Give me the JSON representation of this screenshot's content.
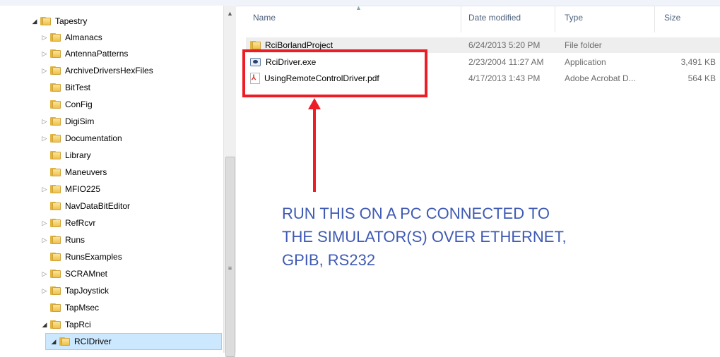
{
  "navigation": {
    "items": [
      {
        "label": "Tapestry",
        "expander": "open"
      },
      {
        "label": "Almanacs",
        "expander": "closed"
      },
      {
        "label": "AntennaPatterns",
        "expander": "closed"
      },
      {
        "label": "ArchiveDriversHexFiles",
        "expander": "closed"
      },
      {
        "label": "BitTest",
        "expander": "none"
      },
      {
        "label": "ConFig",
        "expander": "none"
      },
      {
        "label": "DigiSim",
        "expander": "closed"
      },
      {
        "label": "Documentation",
        "expander": "closed"
      },
      {
        "label": "Library",
        "expander": "none"
      },
      {
        "label": "Maneuvers",
        "expander": "none"
      },
      {
        "label": "MFIO225",
        "expander": "closed"
      },
      {
        "label": "NavDataBitEditor",
        "expander": "none"
      },
      {
        "label": "RefRcvr",
        "expander": "closed"
      },
      {
        "label": "Runs",
        "expander": "closed"
      },
      {
        "label": "RunsExamples",
        "expander": "none"
      },
      {
        "label": "SCRAMnet",
        "expander": "closed"
      },
      {
        "label": "TapJoystick",
        "expander": "closed"
      },
      {
        "label": "TapMsec",
        "expander": "none"
      },
      {
        "label": "TapRci",
        "expander": "open"
      },
      {
        "label": "RCIDriver",
        "expander": "open",
        "selected": true
      }
    ]
  },
  "file_list": {
    "columns": {
      "name": "Name",
      "date": "Date modified",
      "type": "Type",
      "size": "Size"
    },
    "files": [
      {
        "name": "RciBorlandProject",
        "date": "6/24/2013 5:20 PM",
        "type": "File folder",
        "size": "",
        "icon": "folder-icon"
      },
      {
        "name": "RciDriver.exe",
        "date": "2/23/2004 11:27 AM",
        "type": "Application",
        "size": "3,491 KB",
        "icon": "application-icon"
      },
      {
        "name": "UsingRemoteControlDriver.pdf",
        "date": "4/17/2013 1:43 PM",
        "type": "Adobe Acrobat D...",
        "size": "564 KB",
        "icon": "pdf-icon"
      }
    ]
  },
  "annotation": {
    "lines": [
      "RUN THIS ON  A PC CONNECTED TO",
      "THE SIMULATOR(S) OVER ETHERNET,",
      "GPIB, RS232"
    ],
    "color": "#3f5ab4",
    "highlight_color": "#ee1c24"
  },
  "icons": {
    "expand_open": "◢",
    "expand_closed": "▷",
    "scroll_up": "▲",
    "scroll_grip": "≡",
    "sort": "▲"
  }
}
